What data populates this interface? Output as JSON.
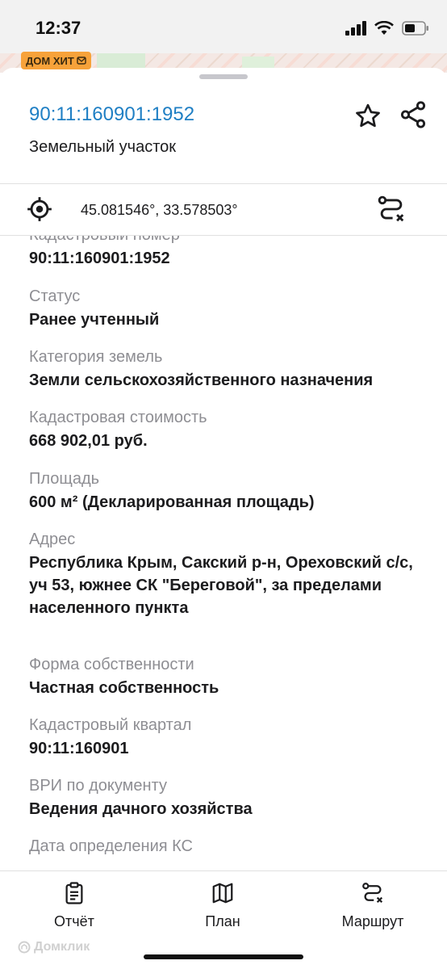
{
  "status_bar": {
    "time": "12:37"
  },
  "map": {
    "badge": "ДОМ ХИТ"
  },
  "header": {
    "title": "90:11:160901:1952",
    "subtitle": "Земельный участок",
    "title_color": "#1f7fc4"
  },
  "coords": {
    "text": "45.081546°, 33.578503°"
  },
  "properties": [
    {
      "label": "Кадастровый номер",
      "value": "90:11:160901:1952"
    },
    {
      "label": "Статус",
      "value": "Ранее учтенный"
    },
    {
      "label": "Категория земель",
      "value": "Земли сельскохозяйственного назначения"
    },
    {
      "label": "Кадастровая стоимость",
      "value": "668 902,01 руб."
    },
    {
      "label": "Площадь",
      "value": "600 м² (Декларированная площадь)"
    },
    {
      "label": "Адрес",
      "value": "Республика Крым, Сакский р-н, Ореховский с/с, уч 53, южнее СК \"Береговой\", за пределами населенного пункта"
    },
    {
      "label": "Форма собственности",
      "value": "Частная собственность"
    },
    {
      "label": "Кадастровый квартал",
      "value": "90:11:160901"
    },
    {
      "label": "ВРИ по документу",
      "value": "Ведения дачного хозяйства"
    },
    {
      "label": "Дата определения КС",
      "value": ""
    }
  ],
  "bottom_bar": {
    "report": "Отчёт",
    "plan": "План",
    "route": "Маршрут"
  },
  "watermark": "Домклик"
}
